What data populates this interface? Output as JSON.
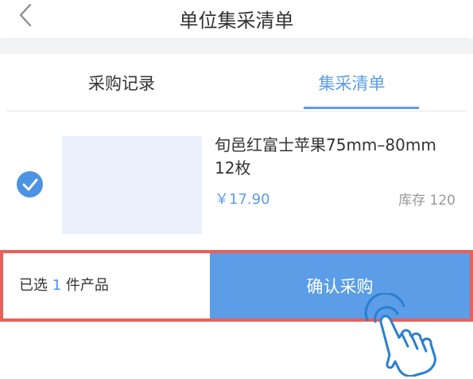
{
  "header": {
    "title": "单位集采清单",
    "back_icon": "chevron-left-icon"
  },
  "tabs": [
    {
      "label": "采购记录",
      "active": false
    },
    {
      "label": "集采清单",
      "active": true
    }
  ],
  "product": {
    "name_line1": "旬邑红富士苹果75mm–80mm",
    "name_line2": "12枚",
    "price": "￥17.90",
    "stock_label": "库存",
    "stock_value": "120",
    "checked": true
  },
  "footer": {
    "selected_prefix": "已选",
    "selected_count": "1",
    "selected_suffix": "件产品",
    "confirm_label": "确认采购"
  },
  "colors": {
    "accent": "#5b9de6",
    "check": "#4c93e3",
    "highlight_border": "#e8605a",
    "thumbnail": "#eaf1fd"
  },
  "annotation_icon": "tap-hand-icon"
}
